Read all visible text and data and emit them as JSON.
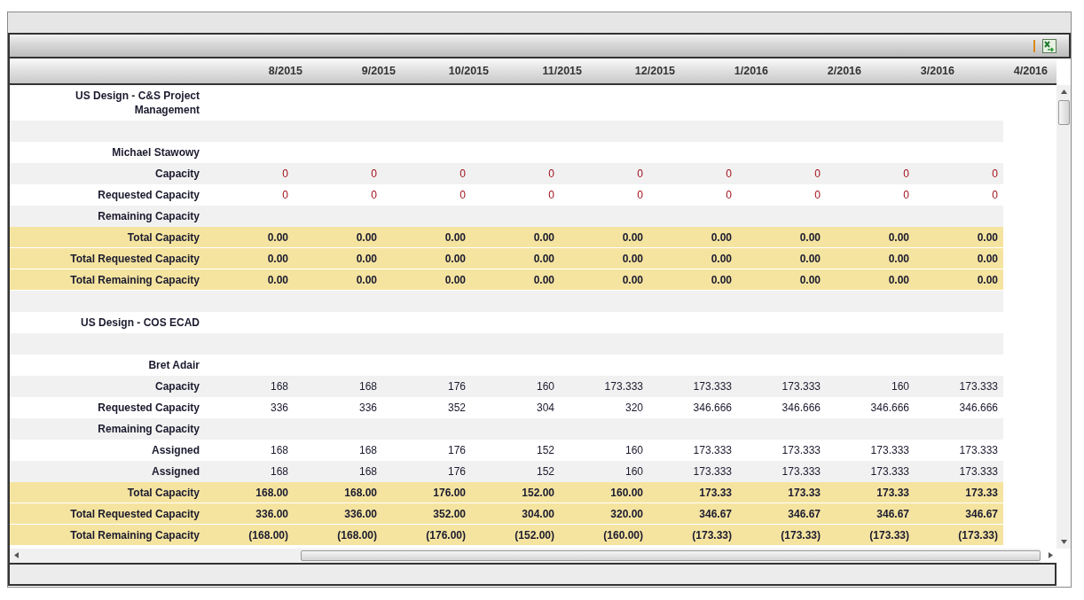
{
  "columns": [
    "8/2015",
    "9/2015",
    "10/2015",
    "11/2015",
    "12/2015",
    "1/2016",
    "2/2016",
    "3/2016",
    "4/2016"
  ],
  "rows": [
    {
      "kind": "group",
      "label": "US Design - C&S Project Management"
    },
    {
      "kind": "blank"
    },
    {
      "kind": "person",
      "label": "Michael Stawowy"
    },
    {
      "kind": "data",
      "label": "Capacity",
      "alert": true,
      "values": [
        "0",
        "0",
        "0",
        "0",
        "0",
        "0",
        "0",
        "0",
        "0"
      ]
    },
    {
      "kind": "data",
      "label": "Requested Capacity",
      "alert": true,
      "values": [
        "0",
        "0",
        "0",
        "0",
        "0",
        "0",
        "0",
        "0",
        "0"
      ]
    },
    {
      "kind": "data",
      "label": "Remaining Capacity",
      "values": []
    },
    {
      "kind": "total",
      "label": "Total Capacity",
      "values": [
        "0.00",
        "0.00",
        "0.00",
        "0.00",
        "0.00",
        "0.00",
        "0.00",
        "0.00",
        "0.00"
      ]
    },
    {
      "kind": "total",
      "label": "Total Requested Capacity",
      "values": [
        "0.00",
        "0.00",
        "0.00",
        "0.00",
        "0.00",
        "0.00",
        "0.00",
        "0.00",
        "0.00"
      ]
    },
    {
      "kind": "total",
      "label": "Total Remaining Capacity",
      "values": [
        "0.00",
        "0.00",
        "0.00",
        "0.00",
        "0.00",
        "0.00",
        "0.00",
        "0.00",
        "0.00"
      ]
    },
    {
      "kind": "blank"
    },
    {
      "kind": "group",
      "label": "US Design - COS ECAD"
    },
    {
      "kind": "blank"
    },
    {
      "kind": "person",
      "label": "Bret Adair"
    },
    {
      "kind": "data",
      "label": "Capacity",
      "alert": false,
      "values": [
        "168",
        "168",
        "176",
        "160",
        "173.333",
        "173.333",
        "173.333",
        "160",
        "173.333"
      ]
    },
    {
      "kind": "data",
      "label": "Requested Capacity",
      "alert": false,
      "values": [
        "336",
        "336",
        "352",
        "304",
        "320",
        "346.666",
        "346.666",
        "346.666",
        "346.666"
      ]
    },
    {
      "kind": "data",
      "label": "Remaining Capacity",
      "values": []
    },
    {
      "kind": "data",
      "label": "Assigned",
      "alert": false,
      "values": [
        "168",
        "168",
        "176",
        "152",
        "160",
        "173.333",
        "173.333",
        "173.333",
        "173.333"
      ]
    },
    {
      "kind": "data",
      "label": "Assigned",
      "alert": false,
      "values": [
        "168",
        "168",
        "176",
        "152",
        "160",
        "173.333",
        "173.333",
        "173.333",
        "173.333"
      ]
    },
    {
      "kind": "total",
      "label": "Total Capacity",
      "values": [
        "168.00",
        "168.00",
        "176.00",
        "152.00",
        "160.00",
        "173.33",
        "173.33",
        "173.33",
        "173.33"
      ]
    },
    {
      "kind": "total",
      "label": "Total Requested Capacity",
      "values": [
        "336.00",
        "336.00",
        "352.00",
        "304.00",
        "320.00",
        "346.67",
        "346.67",
        "346.67",
        "346.67"
      ]
    },
    {
      "kind": "total",
      "label": "Total Remaining Capacity",
      "values": [
        "(168.00)",
        "(168.00)",
        "(176.00)",
        "(152.00)",
        "(160.00)",
        "(173.33)",
        "(173.33)",
        "(173.33)",
        "(173.33)"
      ]
    }
  ]
}
